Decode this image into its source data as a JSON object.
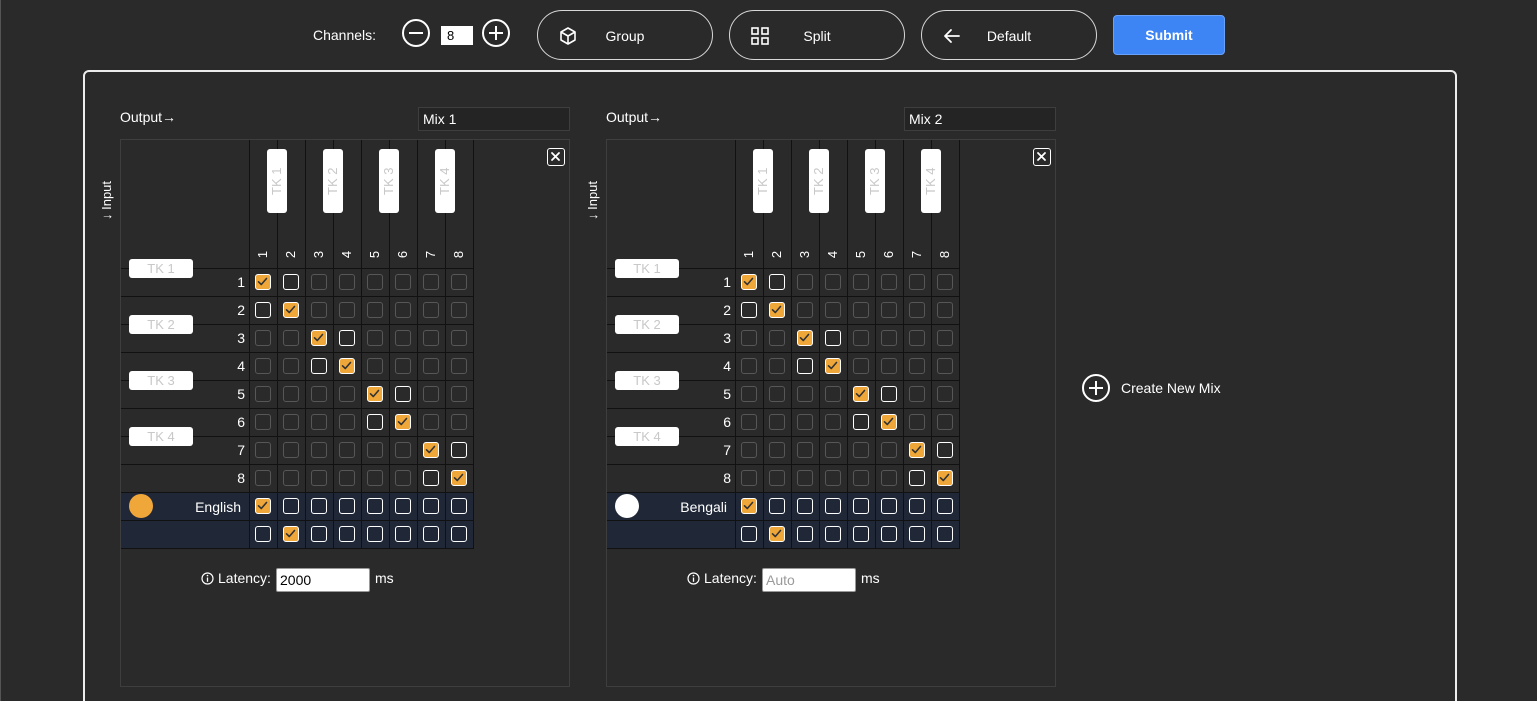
{
  "topbar": {
    "channels_label": "Channels:",
    "channels_value": "8",
    "group_label": "Group",
    "split_label": "Split",
    "default_label": "Default",
    "submit_label": "Submit"
  },
  "create_new_mix_label": "Create New Mix",
  "mixes": [
    {
      "output_label": "Output→",
      "input_label": "↓ Input",
      "name": "Mix 1",
      "track_labels": [
        "TK 1",
        "TK 2",
        "TK 3",
        "TK 4"
      ],
      "column_numbers": [
        "1",
        "2",
        "3",
        "4",
        "5",
        "6",
        "7",
        "8"
      ],
      "row_numbers": [
        "1",
        "2",
        "3",
        "4",
        "5",
        "6",
        "7",
        "8"
      ],
      "language_label": "English",
      "avatar_color": "#f0a73a",
      "latency_label": "Latency:",
      "latency_value": "2000",
      "latency_placeholder": "",
      "latency_unit": "ms",
      "grid_states": [
        [
          "on",
          "off",
          "dim",
          "dim",
          "dim",
          "dim",
          "dim",
          "dim"
        ],
        [
          "off",
          "on",
          "dim",
          "dim",
          "dim",
          "dim",
          "dim",
          "dim"
        ],
        [
          "dim",
          "dim",
          "on",
          "off",
          "dim",
          "dim",
          "dim",
          "dim"
        ],
        [
          "dim",
          "dim",
          "off",
          "on",
          "dim",
          "dim",
          "dim",
          "dim"
        ],
        [
          "dim",
          "dim",
          "dim",
          "dim",
          "on",
          "off",
          "dim",
          "dim"
        ],
        [
          "dim",
          "dim",
          "dim",
          "dim",
          "off",
          "on",
          "dim",
          "dim"
        ],
        [
          "dim",
          "dim",
          "dim",
          "dim",
          "dim",
          "dim",
          "on",
          "off"
        ],
        [
          "dim",
          "dim",
          "dim",
          "dim",
          "dim",
          "dim",
          "off",
          "on"
        ],
        [
          "on",
          "off",
          "off",
          "off",
          "off",
          "off",
          "off",
          "off"
        ],
        [
          "off",
          "on",
          "off",
          "off",
          "off",
          "off",
          "off",
          "off"
        ]
      ]
    },
    {
      "output_label": "Output→",
      "input_label": "↓ Input",
      "name": "Mix 2",
      "track_labels": [
        "TK 1",
        "TK 2",
        "TK 3",
        "TK 4"
      ],
      "column_numbers": [
        "1",
        "2",
        "3",
        "4",
        "5",
        "6",
        "7",
        "8"
      ],
      "row_numbers": [
        "1",
        "2",
        "3",
        "4",
        "5",
        "6",
        "7",
        "8"
      ],
      "language_label": "Bengali",
      "avatar_color": "#ffffff",
      "latency_label": "Latency:",
      "latency_value": "",
      "latency_placeholder": "Auto",
      "latency_unit": "ms",
      "grid_states": [
        [
          "on",
          "off",
          "dim",
          "dim",
          "dim",
          "dim",
          "dim",
          "dim"
        ],
        [
          "off",
          "on",
          "dim",
          "dim",
          "dim",
          "dim",
          "dim",
          "dim"
        ],
        [
          "dim",
          "dim",
          "on",
          "off",
          "dim",
          "dim",
          "dim",
          "dim"
        ],
        [
          "dim",
          "dim",
          "off",
          "on",
          "dim",
          "dim",
          "dim",
          "dim"
        ],
        [
          "dim",
          "dim",
          "dim",
          "dim",
          "on",
          "off",
          "dim",
          "dim"
        ],
        [
          "dim",
          "dim",
          "dim",
          "dim",
          "off",
          "on",
          "dim",
          "dim"
        ],
        [
          "dim",
          "dim",
          "dim",
          "dim",
          "dim",
          "dim",
          "on",
          "off"
        ],
        [
          "dim",
          "dim",
          "dim",
          "dim",
          "dim",
          "dim",
          "off",
          "on"
        ],
        [
          "on",
          "off",
          "off",
          "off",
          "off",
          "off",
          "off",
          "off"
        ],
        [
          "off",
          "on",
          "off",
          "off",
          "off",
          "off",
          "off",
          "off"
        ]
      ]
    }
  ],
  "colors": {
    "background": "#2a2a2a",
    "accent": "#3d84f5",
    "checked": "#f0a73a"
  }
}
